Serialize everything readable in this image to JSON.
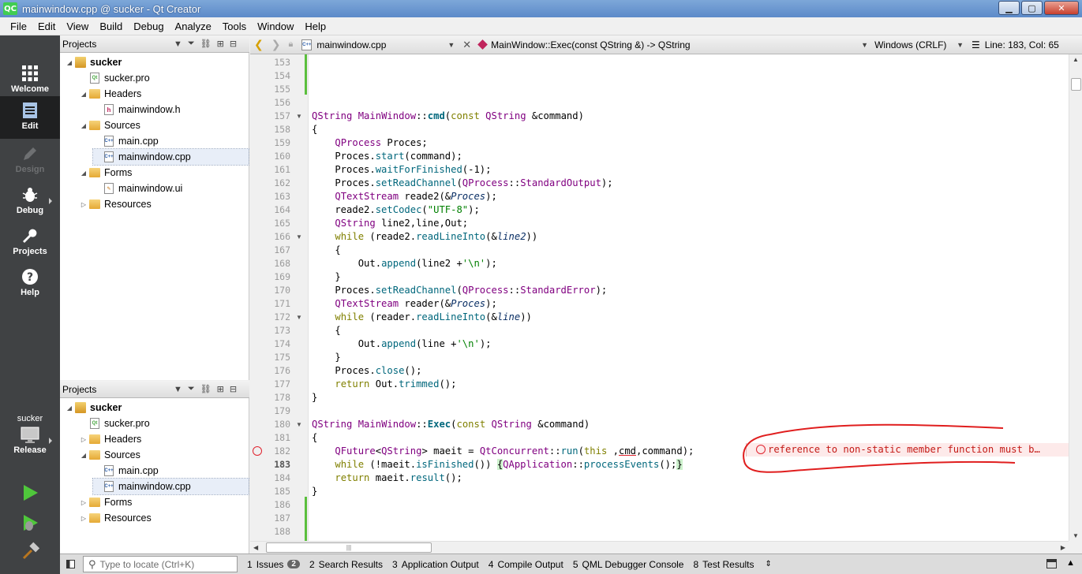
{
  "window": {
    "title": "mainwindow.cpp @ sucker - Qt Creator",
    "app_icon": "QC",
    "min": "▁",
    "max": "▢",
    "close": "✕"
  },
  "menu": [
    "File",
    "Edit",
    "View",
    "Build",
    "Debug",
    "Analyze",
    "Tools",
    "Window",
    "Help"
  ],
  "modes": [
    {
      "label": "Welcome",
      "icon": "grid-icon",
      "state": "normal"
    },
    {
      "label": "Edit",
      "icon": "edit-document-icon",
      "state": "active"
    },
    {
      "label": "Design",
      "icon": "pencil-icon",
      "state": "disabled"
    },
    {
      "label": "Debug",
      "icon": "bug-icon",
      "state": "normal"
    },
    {
      "label": "Projects",
      "icon": "wrench-icon",
      "state": "normal"
    },
    {
      "label": "Help",
      "icon": "question-icon",
      "state": "normal"
    }
  ],
  "kit": {
    "project": "sucker",
    "config": "Release"
  },
  "projects_panel": {
    "title": "Projects",
    "tree": [
      {
        "label": "sucker",
        "level": 0,
        "type": "project",
        "expanded": true,
        "bold": true
      },
      {
        "label": "sucker.pro",
        "level": 1,
        "type": "pro"
      },
      {
        "label": "Headers",
        "level": 1,
        "type": "folder",
        "expanded": true
      },
      {
        "label": "mainwindow.h",
        "level": 2,
        "type": "header"
      },
      {
        "label": "Sources",
        "level": 1,
        "type": "folder",
        "expanded": true
      },
      {
        "label": "main.cpp",
        "level": 2,
        "type": "cpp"
      },
      {
        "label": "mainwindow.cpp",
        "level": 2,
        "type": "cpp",
        "selected": true
      },
      {
        "label": "Forms",
        "level": 1,
        "type": "folder",
        "expanded": true
      },
      {
        "label": "mainwindow.ui",
        "level": 2,
        "type": "ui"
      },
      {
        "label": "Resources",
        "level": 1,
        "type": "lockfolder",
        "expanded": false
      }
    ]
  },
  "projects_panel2": {
    "title": "Projects",
    "tree": [
      {
        "label": "sucker",
        "level": 0,
        "type": "project",
        "expanded": true,
        "bold": true
      },
      {
        "label": "sucker.pro",
        "level": 1,
        "type": "pro"
      },
      {
        "label": "Headers",
        "level": 1,
        "type": "folder",
        "expanded": false
      },
      {
        "label": "Sources",
        "level": 1,
        "type": "folder",
        "expanded": true
      },
      {
        "label": "main.cpp",
        "level": 2,
        "type": "cpp"
      },
      {
        "label": "mainwindow.cpp",
        "level": 2,
        "type": "cpp",
        "selected": true
      },
      {
        "label": "Forms",
        "level": 1,
        "type": "folder",
        "expanded": false
      },
      {
        "label": "Resources",
        "level": 1,
        "type": "lockfolder",
        "expanded": false
      }
    ]
  },
  "editor_toolbar": {
    "file": "mainwindow.cpp",
    "symbol": "MainWindow::Exec(const QString &) -> QString",
    "line_ending": "Windows (CRLF)",
    "position": "Line: 183, Col: 65"
  },
  "error_message": "reference to non-static member function must b…",
  "code_lines": [
    {
      "n": 153
    },
    {
      "n": 154
    },
    {
      "n": 155
    },
    {
      "n": 156
    },
    {
      "n": 157,
      "fold": true,
      "html": "<span class='ty'>QString</span> <span class='ty'>MainWindow</span>::<span class='bold'>cmd</span>(<span class='kw'>const</span> <span class='ty'>QString</span> &amp;command)"
    },
    {
      "n": 158,
      "html": "{"
    },
    {
      "n": 159,
      "html": "    <span class='ty'>QProcess</span> Proces;"
    },
    {
      "n": 160,
      "html": "    Proces.<span class='fn'>start</span>(command);"
    },
    {
      "n": 161,
      "html": "    Proces.<span class='fn'>waitForFinished</span>(-1);"
    },
    {
      "n": 162,
      "html": "    Proces.<span class='fn'>setReadChannel</span>(<span class='ty'>QProcess</span>::<span class='en'>StandardOutput</span>);"
    },
    {
      "n": 163,
      "html": "    <span class='ty'>QTextStream</span> reade2(&amp;<span class='pa'>Proces</span>);"
    },
    {
      "n": 164,
      "html": "    reade2.<span class='fn'>setCodec</span>(<span class='st'>\"UTF-8\"</span>);"
    },
    {
      "n": 165,
      "html": "    <span class='ty'>QString</span> line2,line,Out;"
    },
    {
      "n": 166,
      "fold": true,
      "html": "    <span class='kw'>while</span> (reade2.<span class='fn'>readLineInto</span>(&amp;<span class='pa'>line2</span>))"
    },
    {
      "n": 167,
      "html": "    {"
    },
    {
      "n": 168,
      "html": "        Out.<span class='fn'>append</span>(line2 +<span class='st'>'\\n'</span>);"
    },
    {
      "n": 169,
      "html": "    }"
    },
    {
      "n": 170,
      "html": "    Proces.<span class='fn'>setReadChannel</span>(<span class='ty'>QProcess</span>::<span class='en'>StandardError</span>);"
    },
    {
      "n": 171,
      "html": "    <span class='ty'>QTextStream</span> reader(&amp;<span class='pa'>Proces</span>);"
    },
    {
      "n": 172,
      "fold": true,
      "html": "    <span class='kw'>while</span> (reader.<span class='fn'>readLineInto</span>(&amp;<span class='pa'>line</span>))"
    },
    {
      "n": 173,
      "html": "    {"
    },
    {
      "n": 174,
      "html": "        Out.<span class='fn'>append</span>(line +<span class='st'>'\\n'</span>);"
    },
    {
      "n": 175,
      "html": "    }"
    },
    {
      "n": 176,
      "html": "    Proces.<span class='fn'>close</span>();"
    },
    {
      "n": 177,
      "html": "    <span class='kw'>return</span> Out.<span class='fn'>trimmed</span>();"
    },
    {
      "n": 178,
      "html": "}"
    },
    {
      "n": 179
    },
    {
      "n": 180,
      "fold": true,
      "html": "<span class='ty'>QString</span> <span class='ty'>MainWindow</span>::<span class='bold'>Exec</span>(<span class='kw'>const</span> <span class='ty'>QString</span> &amp;command)"
    },
    {
      "n": 181,
      "html": "{"
    },
    {
      "n": 182,
      "error": true,
      "html": "    <span class='ty'>QFuture</span>&lt;<span class='ty'>QString</span>&gt; maeit = <span class='ty'>QtConcurrent</span>::<span class='fn'>run</span>(<span class='kw'>this</span> ,<span class='ul'>cmd</span>,command);"
    },
    {
      "n": 183,
      "current": true,
      "html": "    <span class='kw'>while</span> (!maeit.<span class='fn'>isFinished</span>()) <span class='hl'>{</span><span class='ty'>QApplication</span>::<span class='fn'>processEvents</span>();<span class='hl'>}</span>"
    },
    {
      "n": 184,
      "html": "    <span class='kw'>return</span> maeit.<span class='fn'>result</span>();"
    },
    {
      "n": 185,
      "html": "}"
    },
    {
      "n": 186
    },
    {
      "n": 187
    },
    {
      "n": 188
    }
  ],
  "status_bar": {
    "locate_placeholder": "Type to locate (Ctrl+K)",
    "tabs": [
      {
        "num": "1",
        "label": "Issues",
        "badge": "2"
      },
      {
        "num": "2",
        "label": "Search Results"
      },
      {
        "num": "3",
        "label": "Application Output"
      },
      {
        "num": "4",
        "label": "Compile Output"
      },
      {
        "num": "5",
        "label": "QML Debugger Console"
      },
      {
        "num": "8",
        "label": "Test Results"
      }
    ]
  }
}
